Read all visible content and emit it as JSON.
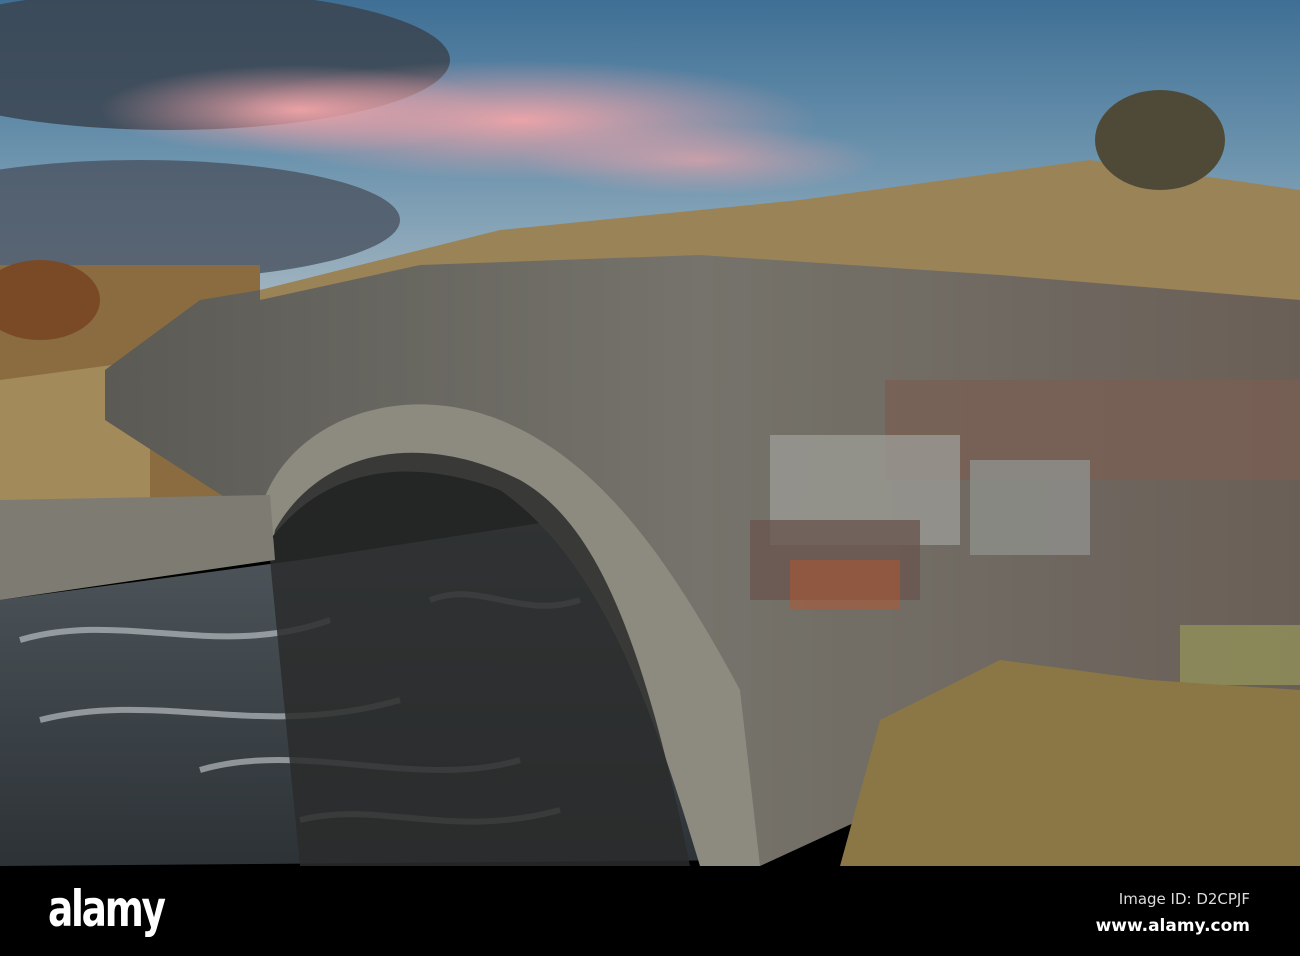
{
  "photo": {
    "subject": "stone-arch-bridge-over-stream"
  },
  "footer": {
    "logo": "alamy",
    "image_id": "Image ID: D2CPJF",
    "url": "www.alamy.com"
  }
}
